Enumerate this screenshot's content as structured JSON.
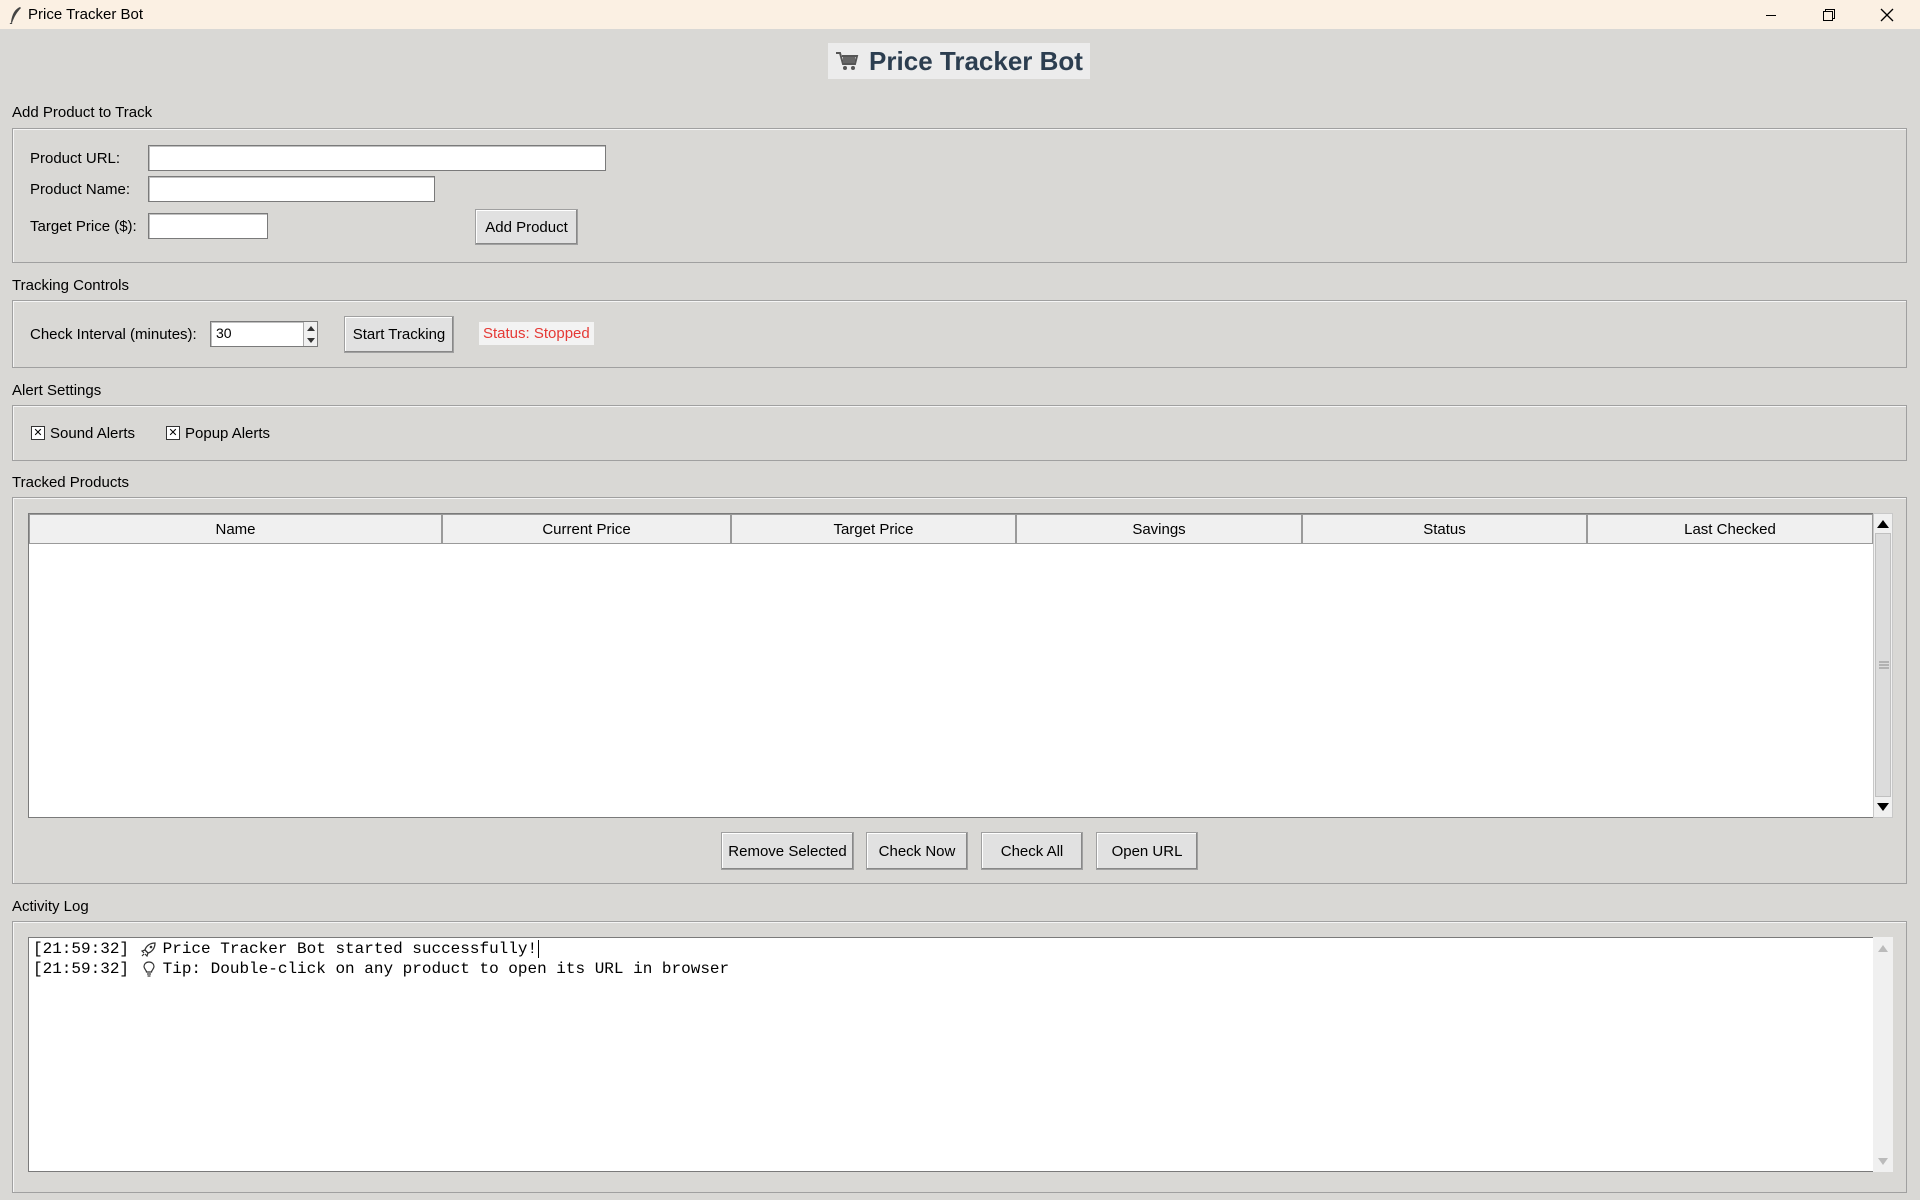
{
  "window": {
    "title": "Price Tracker Bot"
  },
  "header": {
    "title": "Price Tracker Bot",
    "icon": "shopping-cart-icon"
  },
  "add_product": {
    "group_label": "Add Product to Track",
    "url_label": "Product URL:",
    "url_value": "",
    "name_label": "Product Name:",
    "name_value": "",
    "target_label": "Target Price ($):",
    "target_value": "",
    "add_button": "Add Product"
  },
  "tracking": {
    "group_label": "Tracking Controls",
    "interval_label": "Check Interval (minutes):",
    "interval_value": "30",
    "start_button": "Start Tracking",
    "status_text": "Status: Stopped",
    "status_color": "#e53935"
  },
  "alerts": {
    "group_label": "Alert Settings",
    "sound_label": "Sound Alerts",
    "sound_checked": true,
    "popup_label": "Popup Alerts",
    "popup_checked": true,
    "check_mark": "✕"
  },
  "products": {
    "group_label": "Tracked Products",
    "columns": [
      "Name",
      "Current Price",
      "Target Price",
      "Savings",
      "Status",
      "Last Checked"
    ],
    "rows": [],
    "buttons": {
      "remove": "Remove Selected",
      "check_now": "Check Now",
      "check_all": "Check All",
      "open_url": "Open URL"
    }
  },
  "log": {
    "group_label": "Activity Log",
    "lines": [
      {
        "time": "[21:59:32]",
        "icon": "rocket-icon",
        "text": "Price Tracker Bot started successfully!"
      },
      {
        "time": "[21:59:32]",
        "icon": "lightbulb-icon",
        "text": "Tip: Double-click on any product to open its URL in browser"
      }
    ]
  }
}
